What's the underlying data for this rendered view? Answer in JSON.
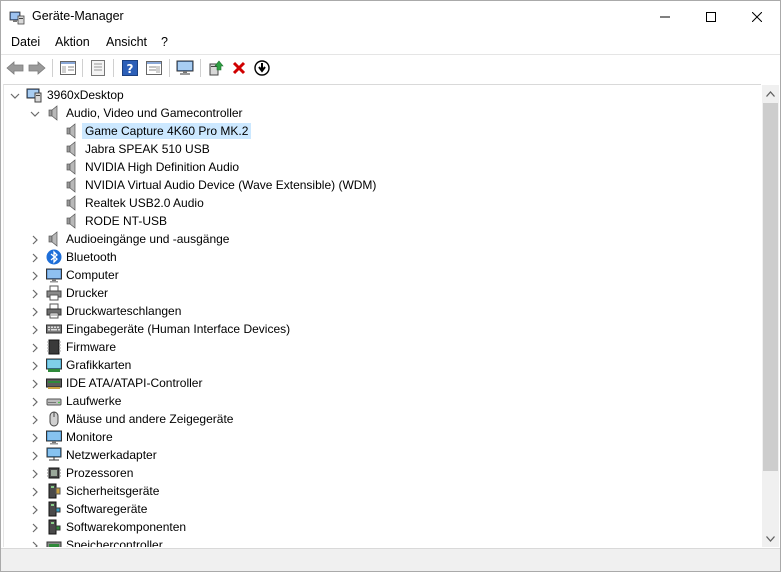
{
  "window": {
    "title": "Geräte-Manager",
    "icon": "device-manager-icon"
  },
  "menubar": {
    "items": [
      {
        "label": "Datei"
      },
      {
        "label": "Aktion"
      },
      {
        "label": "Ansicht"
      },
      {
        "label": "?"
      }
    ]
  },
  "toolbar": {
    "buttons": [
      "back-arrow-icon",
      "forward-arrow-icon",
      "show-hide-console-tree-icon",
      "properties-icon",
      "help-icon",
      "view-icon",
      "monitor-scan-icon",
      "update-driver-icon",
      "uninstall-device-icon",
      "disable-device-icon"
    ]
  },
  "tree": {
    "root": "3960xDesktop",
    "expanded_category": "Audio, Video und Gamecontroller",
    "expanded_children": [
      "Game Capture 4K60 Pro MK.2",
      "Jabra SPEAK 510 USB",
      "NVIDIA High Definition Audio",
      "NVIDIA Virtual Audio Device (Wave Extensible) (WDM)",
      "Realtek USB2.0 Audio",
      "RODE NT-USB"
    ],
    "selected": "Game Capture 4K60 Pro MK.2",
    "categories": [
      {
        "label": "Audioeingänge und -ausgänge",
        "icon": "speaker-icon"
      },
      {
        "label": "Bluetooth",
        "icon": "bluetooth-icon"
      },
      {
        "label": "Computer",
        "icon": "computer-icon"
      },
      {
        "label": "Drucker",
        "icon": "printer-icon"
      },
      {
        "label": "Druckwarteschlangen",
        "icon": "printer-queue-icon"
      },
      {
        "label": "Eingabegeräte (Human Interface Devices)",
        "icon": "keyboard-icon"
      },
      {
        "label": "Firmware",
        "icon": "firmware-icon"
      },
      {
        "label": "Grafikkarten",
        "icon": "display-adapter-icon"
      },
      {
        "label": "IDE ATA/ATAPI-Controller",
        "icon": "ide-controller-icon"
      },
      {
        "label": "Laufwerke",
        "icon": "disk-drive-icon"
      },
      {
        "label": "Mäuse und andere Zeigegeräte",
        "icon": "mouse-icon"
      },
      {
        "label": "Monitore",
        "icon": "monitor-icon"
      },
      {
        "label": "Netzwerkadapter",
        "icon": "network-adapter-icon"
      },
      {
        "label": "Prozessoren",
        "icon": "processor-icon"
      },
      {
        "label": "Sicherheitsgeräte",
        "icon": "security-device-icon"
      },
      {
        "label": "Softwaregeräte",
        "icon": "software-device-icon"
      },
      {
        "label": "Softwarekomponenten",
        "icon": "software-component-icon"
      },
      {
        "label": "Speichercontroller",
        "icon": "storage-controller-icon"
      }
    ]
  },
  "colors": {
    "selection": "#cce8ff",
    "scroll_thumb": "#cdcdcd",
    "uninstall_red": "#d00000"
  }
}
